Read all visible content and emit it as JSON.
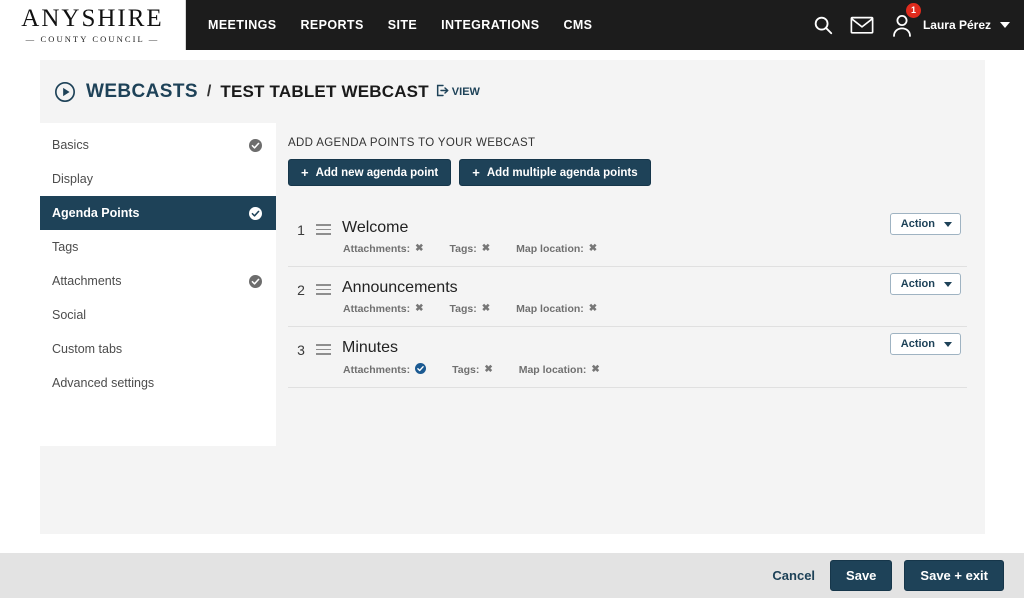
{
  "header": {
    "logo_main": "ANYSHIRE",
    "logo_sub": "— COUNTY COUNCIL —",
    "nav": [
      {
        "label": "MEETINGS"
      },
      {
        "label": "REPORTS"
      },
      {
        "label": "SITE"
      },
      {
        "label": "INTEGRATIONS"
      },
      {
        "label": "CMS"
      }
    ],
    "search_icon": "search-icon",
    "mail_icon": "mail-icon",
    "user_icon": "user-icon",
    "notification_count": "1",
    "username": "Laura Pérez",
    "background": "#1c1c1c"
  },
  "breadcrumb": {
    "play_icon": "play-circle-icon",
    "root": "WEBCASTS",
    "separator": "/",
    "current": "TEST TABLET WEBCAST",
    "view_label": "VIEW",
    "view_icon": "external-link-icon"
  },
  "sidebar": {
    "items": [
      {
        "label": "Basics",
        "active": false,
        "complete": true
      },
      {
        "label": "Display",
        "active": false,
        "complete": false
      },
      {
        "label": "Agenda Points",
        "active": true,
        "complete": true
      },
      {
        "label": "Tags",
        "active": false,
        "complete": false
      },
      {
        "label": "Attachments",
        "active": false,
        "complete": true
      },
      {
        "label": "Social",
        "active": false,
        "complete": false
      },
      {
        "label": "Custom tabs",
        "active": false,
        "complete": false
      },
      {
        "label": "Advanced settings",
        "active": false,
        "complete": false
      }
    ],
    "active_color": "#1e4258"
  },
  "main": {
    "title": "ADD AGENDA POINTS TO YOUR WEBCAST",
    "add_new_label": "Add new agenda point",
    "add_multiple_label": "Add multiple agenda points",
    "plus_glyph": "+",
    "action_label": "Action",
    "meta_labels": {
      "attachments": "Attachments:",
      "tags": "Tags:",
      "map_location": "Map location:"
    },
    "agenda_points": [
      {
        "number": "1",
        "title": "Welcome",
        "attachments": false,
        "tags": false,
        "map_location": false
      },
      {
        "number": "2",
        "title": "Announcements",
        "attachments": false,
        "tags": false,
        "map_location": false
      },
      {
        "number": "3",
        "title": "Minutes",
        "attachments": true,
        "tags": false,
        "map_location": false
      }
    ]
  },
  "footer": {
    "cancel_label": "Cancel",
    "save_label": "Save",
    "save_exit_label": "Save + exit"
  }
}
